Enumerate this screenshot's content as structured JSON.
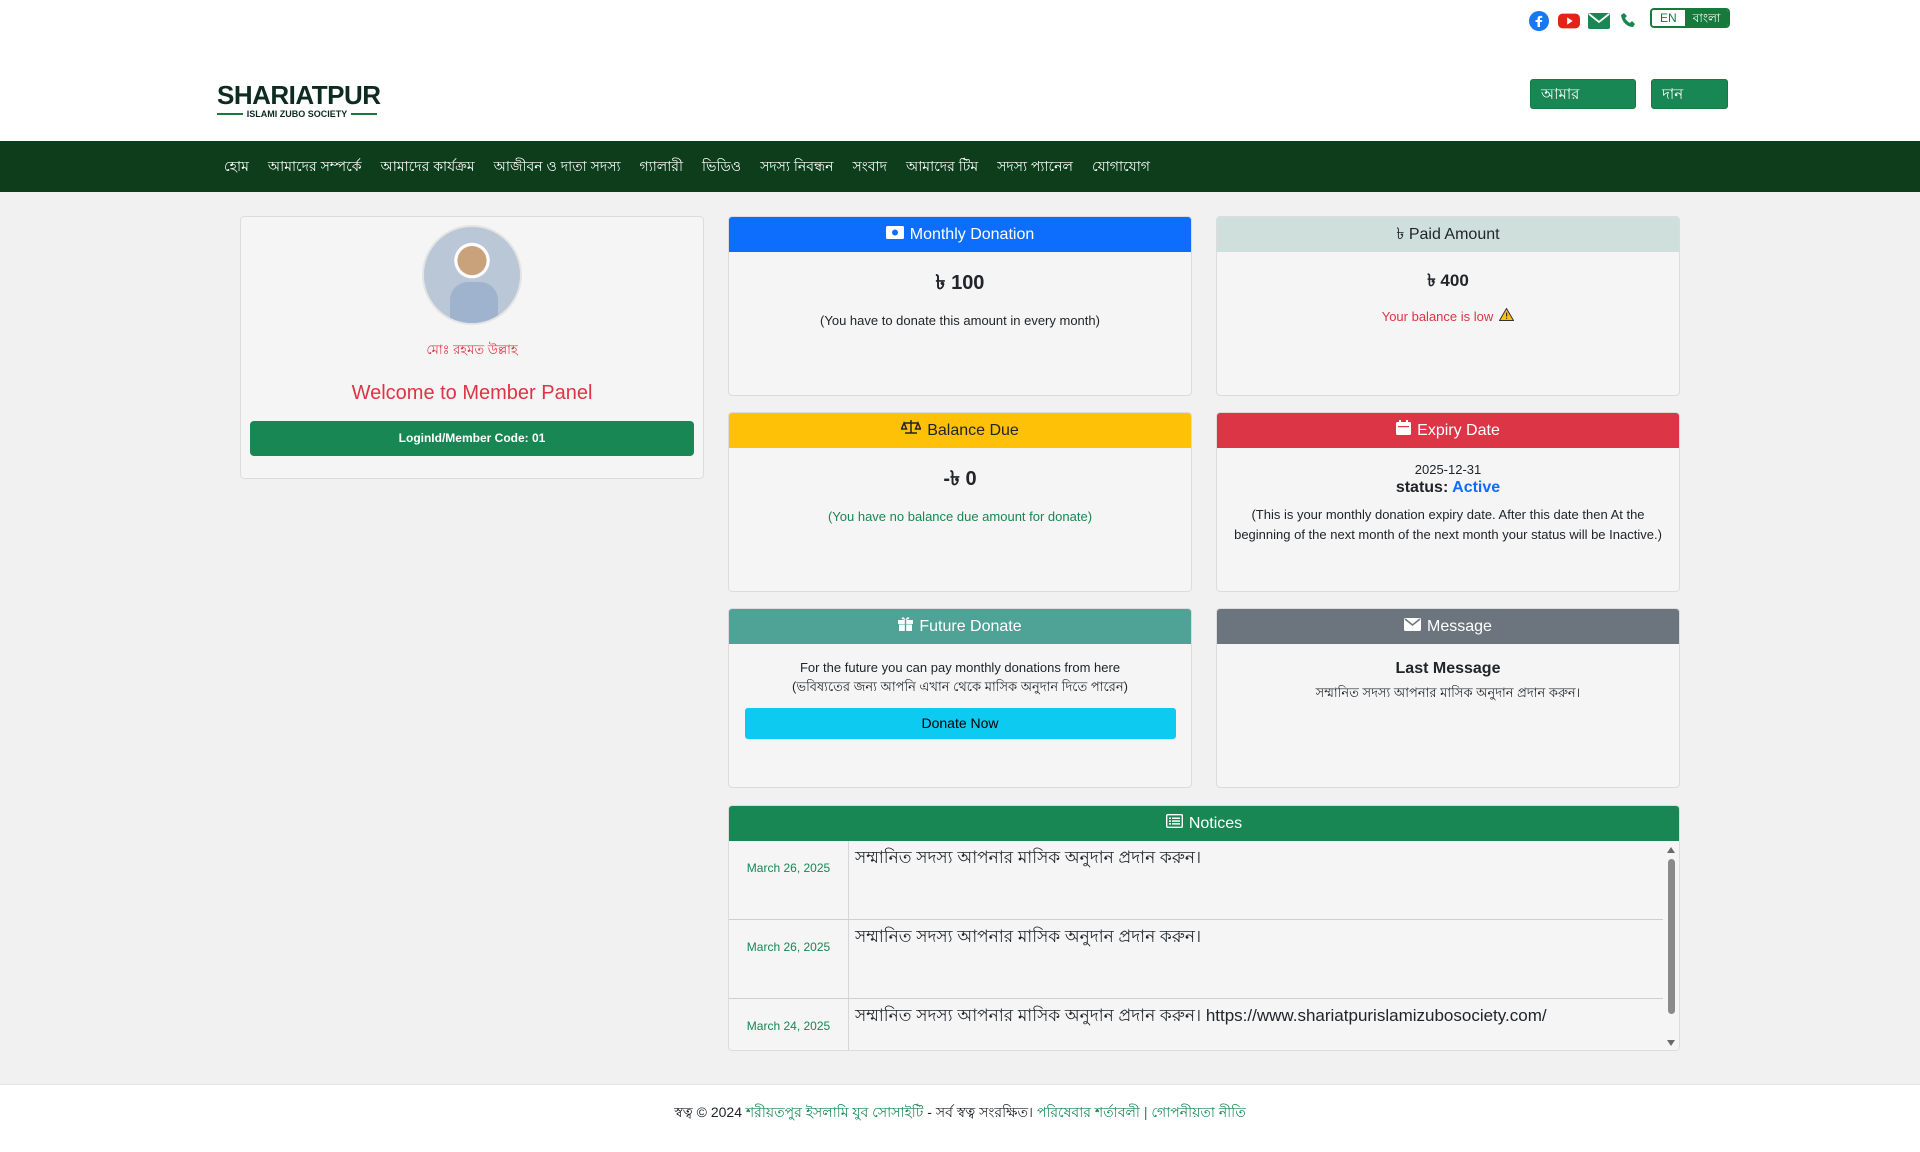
{
  "header": {
    "social_icons": [
      "facebook-icon",
      "youtube-icon",
      "email-icon",
      "phone-icon"
    ],
    "lang_en": "EN",
    "lang_bn": "বাংলা",
    "logo_main": "SHARIATPUR",
    "logo_sub": "ISLAMI ZUBO SOCIETY",
    "my_account": "আমার একাউন্ট",
    "donate": "দান করুন"
  },
  "nav": [
    "হোম",
    "আমাদের সম্পর্কে",
    "আমাদের কার্যক্রম",
    "আজীবন ও দাতা সদস্য",
    "গ্যালারী",
    "ভিডিও",
    "সদস্য নিবন্ধন",
    "সংবাদ",
    "আমাদের টিম",
    "সদস্য প্যানেল",
    "যোগাযোগ"
  ],
  "profile": {
    "name": "মোঃ রহমত উল্লাহ",
    "welcome": "Welcome to Member Panel",
    "login_code": "LoginId/Member Code: 01"
  },
  "monthly": {
    "title": "Monthly Donation",
    "amount": "৳ 100",
    "note": "(You have to donate this amount in every month)"
  },
  "paid": {
    "title": "৳ Paid Amount",
    "amount": "৳ 400",
    "note": "Your balance is low"
  },
  "due": {
    "title": "Balance Due",
    "amount": "-৳ 0",
    "note": "(You have no balance due amount for donate)"
  },
  "expiry": {
    "title": "Expiry Date",
    "date": "2025-12-31",
    "status_label": "status:",
    "status_value": "Active",
    "note": "(This is your monthly donation expiry date. After this date then At the beginning of the next month of the next month your status will be Inactive.)"
  },
  "future": {
    "title": "Future Donate",
    "line1": "For the future you can pay monthly donations from here",
    "line2": "(ভবিষ্যতের জন্য আপনি এখান থেকে মাসিক অনুদান দিতে পারেন)",
    "button": "Donate Now"
  },
  "message": {
    "title": "Message",
    "heading": "Last Message",
    "text": "সম্মানিত সদস্য আপনার মাসিক অনুদান প্রদান করুন।"
  },
  "notices": {
    "title": "Notices",
    "rows": [
      {
        "date": "March 26, 2025",
        "text": "সম্মানিত সদস্য আপনার মাসিক অনুদান প্রদান করুন।"
      },
      {
        "date": "March 26, 2025",
        "text": "সম্মানিত সদস্য আপনার মাসিক অনুদান প্রদান করুন।"
      },
      {
        "date": "March 24, 2025",
        "text": "সম্মানিত সদস্য আপনার মাসিক অনুদান প্রদান করুন। https://www.shariatpurislamizubosociety.com/"
      }
    ]
  },
  "footer": {
    "prefix": "স্বত্ব © 2024",
    "org": "শরীয়তপুর ইসলামি যুব সোসাইটি",
    "rights": " - সর্ব স্বত্ব সংরক্ষিত।",
    "terms": "পরিষেবার শর্তাবলী",
    "sep": "|",
    "privacy": "গোপনীয়তা নীতি"
  },
  "colors": {
    "primary_green": "#198754",
    "nav_bg": "#0e3d1c",
    "monthly": "#0d6efd",
    "paid": "#cfe0dc",
    "due": "#ffc107",
    "expiry": "#dc3545",
    "future": "#4fa296",
    "message": "#6c757d"
  }
}
